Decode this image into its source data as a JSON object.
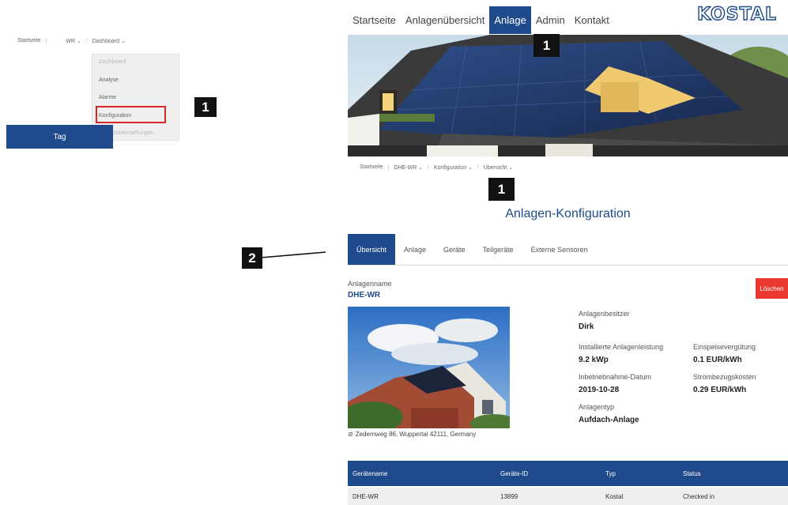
{
  "mini": {
    "nav": {
      "home": "Startseite",
      "wr": "WR",
      "dashboard": "Dashboard"
    },
    "dropdown": [
      "Dashboard",
      "Analyse",
      "Alarme",
      "Konfiguration",
      "Benutzereinstellungen"
    ],
    "tag_button": "Tag",
    "badge": "1"
  },
  "topnav": {
    "items": [
      "Startseite",
      "Anlagenübersicht",
      "Anlage",
      "Admin",
      "Kontakt"
    ],
    "active_index": 2,
    "logo": "KOSTAL"
  },
  "badges": {
    "one": "1",
    "two": "2"
  },
  "breadcrumb": {
    "home": "Startseite",
    "device": "DHE-WR",
    "section": "Konfiguration",
    "page": "Übersicht"
  },
  "page_title": "Anlagen-Konfiguration",
  "tabs": [
    "Übersicht",
    "Anlage",
    "Geräte",
    "Teilgeräte",
    "Externe Sensoren"
  ],
  "overview": {
    "name_label": "Anlagenname",
    "name_value": "DHE-WR",
    "delete_button": "Löschen",
    "address": "Zedernweg 86, Wuppertal 42111, Germany",
    "owner_label": "Anlagenbesitzer",
    "owner_value": "Dirk",
    "power_label": "Installierte Anlagenleistung",
    "power_value": "9.2 kWp",
    "feedin_label": "Einspeisevergütung",
    "feedin_value": "0.1 EUR/kWh",
    "date_label": "Inbetriebnahme-Datum",
    "date_value": "2019-10-28",
    "cost_label": "Strombezugskosten",
    "cost_value": "0.29 EUR/kWh",
    "type_label": "Anlagentyp",
    "type_value": "Aufdach-Anlage"
  },
  "table": {
    "headers": [
      "Gerätename",
      "Geräte-ID",
      "Typ",
      "Status"
    ],
    "rows": [
      [
        "DHE-WR",
        "13899",
        "Kostal",
        "Checked in"
      ]
    ]
  },
  "colors": {
    "primary": "#1f4a8c",
    "danger": "#e8382f",
    "highlight": "#d9272e"
  }
}
